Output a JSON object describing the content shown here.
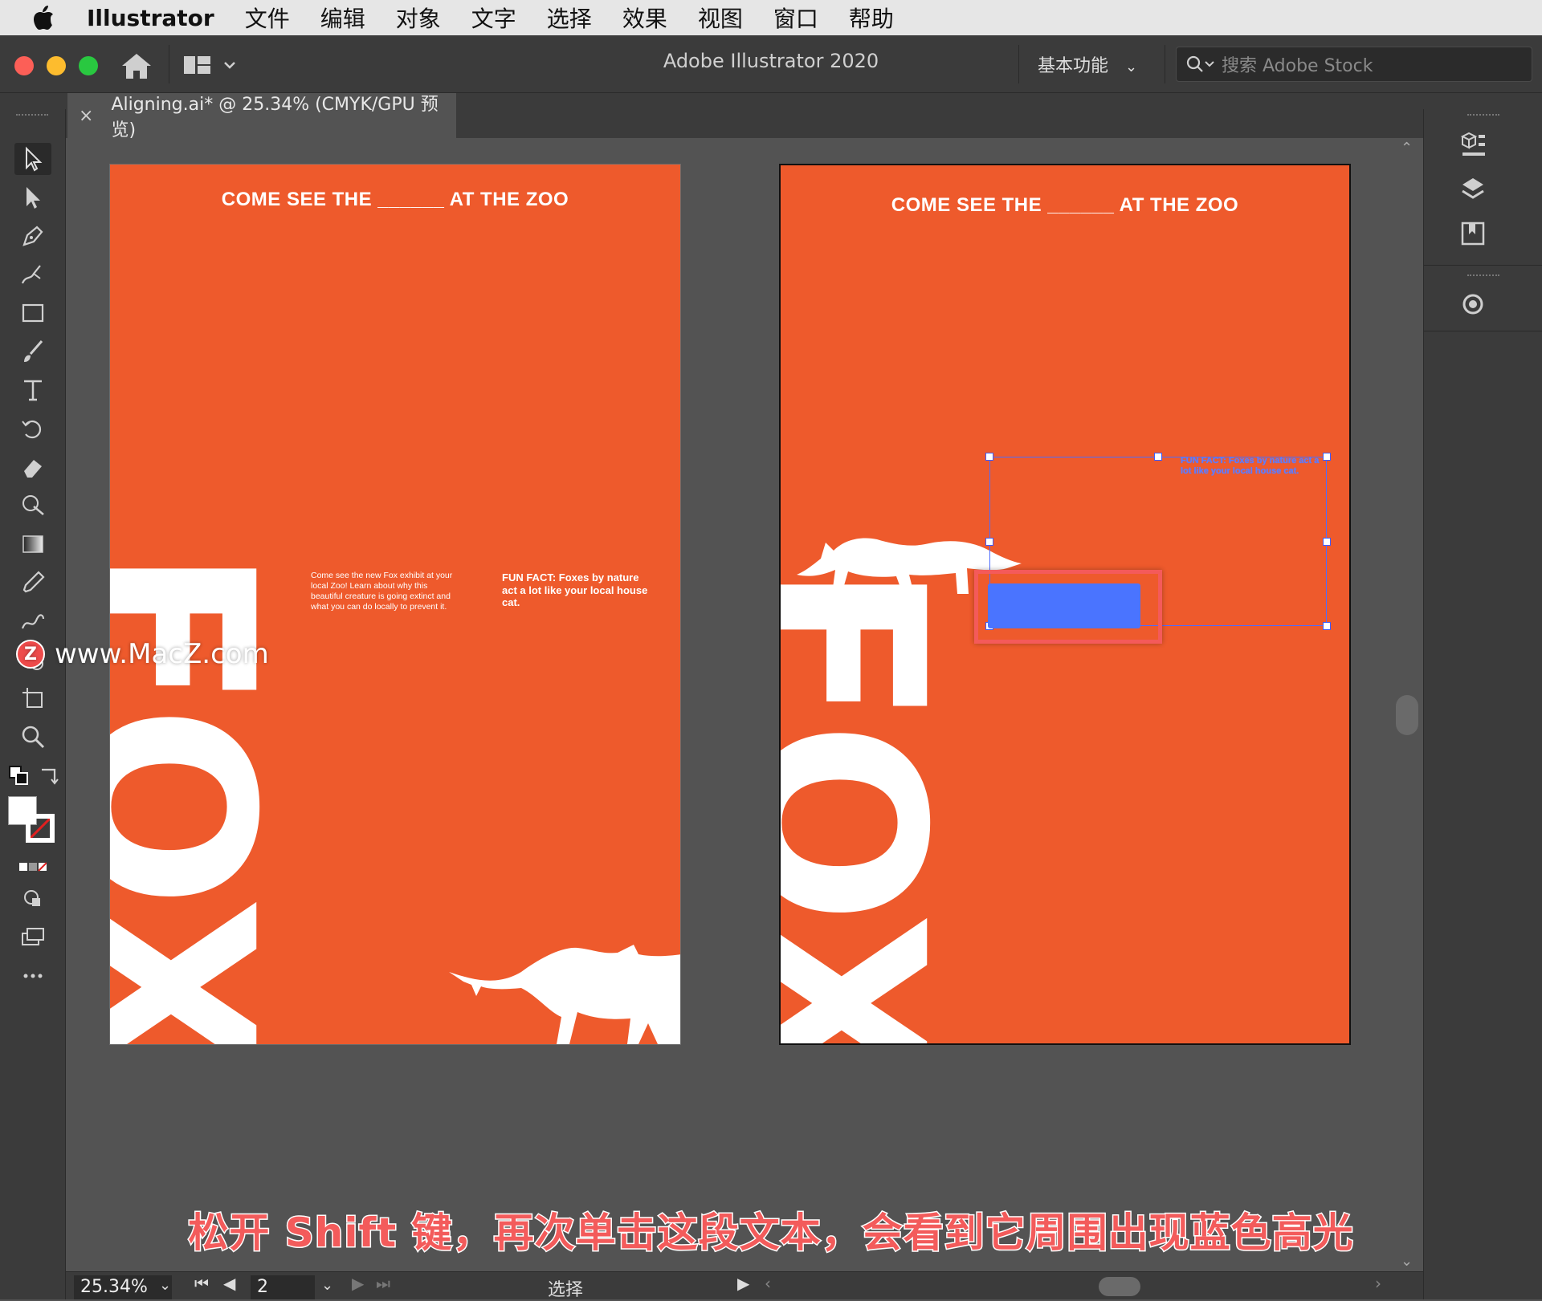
{
  "menubar": {
    "app_name": "Illustrator",
    "items": [
      "文件",
      "编辑",
      "对象",
      "文字",
      "选择",
      "效果",
      "视图",
      "窗口",
      "帮助"
    ]
  },
  "titlebar": {
    "title": "Adobe Illustrator 2020",
    "workspace": "基本功能",
    "search_placeholder": "搜索 Adobe Stock"
  },
  "document_tab": {
    "label": "Aligning.ai* @ 25.34% (CMYK/GPU 预览)",
    "close": "×"
  },
  "artboard_left": {
    "title": "COME SEE THE ______ AT THE ZOO",
    "big_word": "FOX",
    "body": "Come see the new Fox exhibit at your local Zoo! Learn about why this beautiful creature is going extinct and what you can do locally to prevent it.",
    "fun_fact": "FUN FACT: Foxes by nature act a lot like your local house cat."
  },
  "artboard_right": {
    "title": "COME SEE THE ______ AT THE ZOO",
    "big_word": "FOX",
    "fun_fact_selected": "FUN FACT: Foxes by nature act a lot like your local house cat."
  },
  "statusbar": {
    "zoom": "25.34%",
    "page": "2",
    "tool": "选择"
  },
  "caption": "松开 Shift 键，再次单击这段文本，会看到它周围出现蓝色高光",
  "watermark": {
    "logo_letter": "Z",
    "text": "www.MacZ.com"
  },
  "colors": {
    "artboard": "#ee5a2c",
    "selection": "#4d6cff",
    "caption": "#f35b5b",
    "highlight_box": "#f45a5a"
  }
}
